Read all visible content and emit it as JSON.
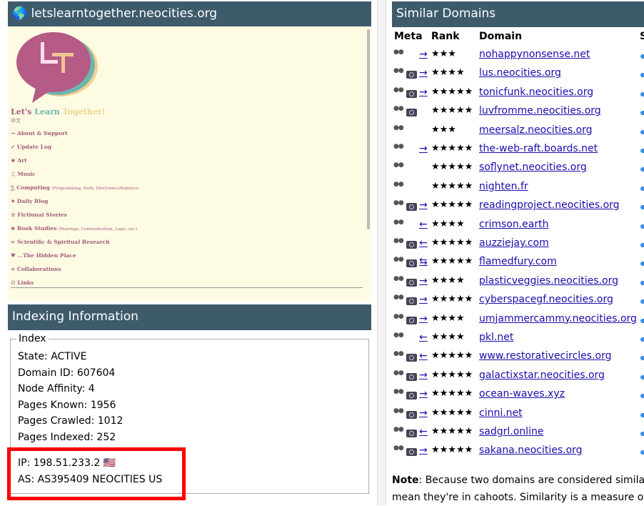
{
  "left": {
    "site_title": "letslearntogether.neocities.org",
    "globe_icon": "globe-icon",
    "preview": {
      "title_a": "Let's ",
      "title_b": "Learn ",
      "title_c": "Together!",
      "lang": "中文",
      "menu": [
        {
          "label": "→ About & Support",
          "sub": ""
        },
        {
          "label": "✓ Update Log",
          "sub": ""
        },
        {
          "label": "★ Art",
          "sub": ""
        },
        {
          "label": "♫ Music",
          "sub": ""
        },
        {
          "label": "∑ Computing",
          "sub": "(Programming, Math, Electronics/Robotics)"
        },
        {
          "label": "✦ Daily Blog",
          "sub": ""
        },
        {
          "label": "☆ Fictional Stories",
          "sub": ""
        },
        {
          "label": "⊕ Book Studies",
          "sub": "(Marriage, Communication, Logic, etc.)"
        },
        {
          "label": "∞ Scientific & Spiritual Research",
          "sub": ""
        },
        {
          "label": "♥ ...The Hidden Place",
          "sub": ""
        },
        {
          "label": "+ Collaborations",
          "sub": ""
        },
        {
          "label": "☺ Links",
          "sub": ""
        }
      ]
    },
    "indexing_title": "Indexing Information",
    "legend": "Index",
    "fields": [
      "State: ACTIVE",
      "Domain ID: 607604",
      "Node Affinity: 4",
      "Pages Known: 1956",
      "Pages Crawled: 1012",
      "Pages Indexed: 252"
    ],
    "ip": "IP: 198.51.233.2",
    "flag": "🇺🇸",
    "as": "AS: AS395409 NEOCITIES US",
    "highlight_color": "#ff0000"
  },
  "right": {
    "title": "Similar Domains",
    "headers": {
      "meta": "Meta",
      "rank": "Rank",
      "domain": "Domain",
      "s": "S"
    },
    "rows": [
      {
        "cam": false,
        "arrow": "→",
        "stars": "★★★",
        "domain": "nohappynonsense.net"
      },
      {
        "cam": true,
        "arrow": "→",
        "stars": "★★★★",
        "domain": "lus.neocities.org"
      },
      {
        "cam": true,
        "arrow": "→",
        "stars": "★★★★★",
        "domain": "tonicfunk.neocities.org"
      },
      {
        "cam": true,
        "arrow": "",
        "stars": "★★★★★",
        "domain": "luvfromme.neocities.org"
      },
      {
        "cam": false,
        "arrow": "",
        "stars": "★★★",
        "domain": "meersalz.neocities.org"
      },
      {
        "cam": false,
        "arrow": "→",
        "stars": "★★★★★",
        "domain": "the-web-raft.boards.net"
      },
      {
        "cam": false,
        "arrow": "",
        "stars": "★★★★★",
        "domain": "soflynet.neocities.org"
      },
      {
        "cam": false,
        "arrow": "",
        "stars": "★★★★★",
        "domain": "nighten.fr"
      },
      {
        "cam": true,
        "arrow": "→",
        "stars": "★★★★★",
        "domain": "readingproject.neocities.org"
      },
      {
        "cam": false,
        "arrow": "←",
        "stars": "★★★★",
        "domain": "crimson.earth"
      },
      {
        "cam": true,
        "arrow": "←",
        "stars": "★★★★★",
        "domain": "auzziejay.com"
      },
      {
        "cam": true,
        "arrow": "⇆",
        "stars": "★★★★★",
        "domain": "flamedfury.com"
      },
      {
        "cam": true,
        "arrow": "→",
        "stars": "★★★★",
        "domain": "plasticveggies.neocities.org"
      },
      {
        "cam": true,
        "arrow": "→",
        "stars": "★★★★★",
        "domain": "cyberspacegf.neocities.org"
      },
      {
        "cam": true,
        "arrow": "→",
        "stars": "★★★★",
        "domain": "umjammercammy.neocities.org"
      },
      {
        "cam": false,
        "arrow": "←",
        "stars": "★★★★",
        "domain": "pkl.net"
      },
      {
        "cam": true,
        "arrow": "←",
        "stars": "★★★★★",
        "domain": "www.restorativecircles.org"
      },
      {
        "cam": true,
        "arrow": "→",
        "stars": "★★★★★",
        "domain": "galactixstar.neocities.org"
      },
      {
        "cam": true,
        "arrow": "→",
        "stars": "★★★★★",
        "domain": "ocean-waves.xyz"
      },
      {
        "cam": true,
        "arrow": "→",
        "stars": "★★★★★",
        "domain": "cinni.net"
      },
      {
        "cam": true,
        "arrow": "←",
        "stars": "★★★★★",
        "domain": "sadgrl.online"
      },
      {
        "cam": true,
        "arrow": "→",
        "stars": "★★★★★",
        "domain": "sakana.neocities.org"
      }
    ],
    "note_label": "Note",
    "note_line1": ": Because two domains are considered similar doesn't",
    "note_line2": "mean they're in cahoots. Similarity is a measure of"
  }
}
